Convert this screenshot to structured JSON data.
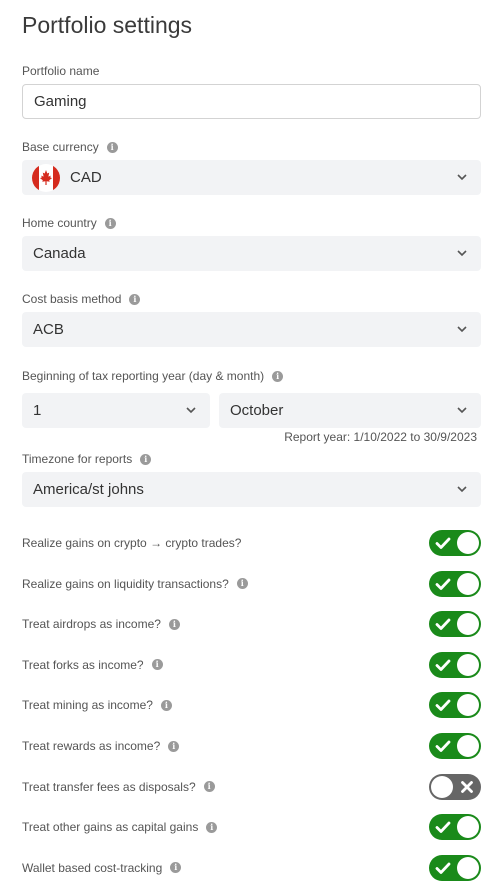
{
  "title": "Portfolio settings",
  "portfolio_name": {
    "label": "Portfolio name",
    "value": "Gaming"
  },
  "base_currency": {
    "label": "Base currency",
    "value": "CAD",
    "flag": "canada-flag-icon"
  },
  "home_country": {
    "label": "Home country",
    "value": "Canada"
  },
  "cost_basis": {
    "label": "Cost basis method",
    "value": "ACB"
  },
  "tax_year": {
    "label": "Beginning of tax reporting year (day & month)",
    "day": "1",
    "month": "October",
    "report_year": "Report year: 1/10/2022 to 30/9/2023"
  },
  "timezone": {
    "label": "Timezone for reports",
    "value": "America/st johns"
  },
  "toggles": [
    {
      "label": "Realize gains on crypto → crypto trades?",
      "on": true,
      "info": false
    },
    {
      "label": "Realize gains on liquidity transactions?",
      "on": true,
      "info": true
    },
    {
      "label": "Treat airdrops as income?",
      "on": true,
      "info": true
    },
    {
      "label": "Treat forks as income?",
      "on": true,
      "info": true
    },
    {
      "label": "Treat mining as income?",
      "on": true,
      "info": true
    },
    {
      "label": "Treat rewards as income?",
      "on": true,
      "info": true
    },
    {
      "label": "Treat transfer fees as disposals?",
      "on": false,
      "info": true
    },
    {
      "label": "Treat other gains as capital gains",
      "on": true,
      "info": true
    },
    {
      "label": "Wallet based cost-tracking",
      "on": true,
      "info": true
    }
  ],
  "colors": {
    "toggle_on": "#1a8a1a",
    "toggle_off": "#666666",
    "select_bg": "#f2f3f5"
  }
}
